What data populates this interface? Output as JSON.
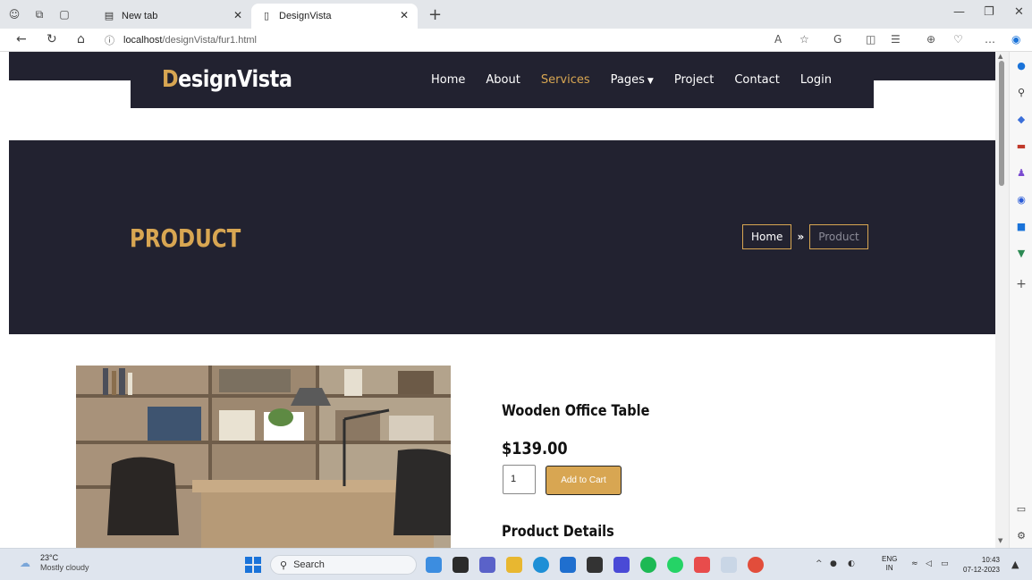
{
  "browser": {
    "tabs": [
      {
        "label": "New tab",
        "active": false,
        "icon": "new-tab-page-icon"
      },
      {
        "label": "DesignVista",
        "active": true,
        "icon": "page-icon"
      }
    ],
    "url_host": "localhost",
    "url_path": "/designVista/fur1.html"
  },
  "site": {
    "logo_first": "D",
    "logo_rest": "esignVista",
    "nav": [
      {
        "label": "Home"
      },
      {
        "label": "About"
      },
      {
        "label": "Services",
        "active": true
      },
      {
        "label": "Pages"
      },
      {
        "label": "Project"
      },
      {
        "label": "Contact"
      },
      {
        "label": "Login"
      }
    ],
    "colors": {
      "accent": "#d8a652",
      "dark": "#222230"
    }
  },
  "hero": {
    "title": "PRODUCT",
    "breadcrumb_home": "Home",
    "breadcrumb_current": "Product"
  },
  "product": {
    "name": "Wooden Office Table",
    "price": "$139.00",
    "quantity": "1",
    "add_to_cart": "Add to Cart",
    "details_heading": "Product Details"
  },
  "taskbar": {
    "temperature": "23°C",
    "condition": "Mostly cloudy",
    "search_placeholder": "Search",
    "lang_1": "ENG",
    "lang_2": "IN",
    "time": "10:43",
    "date": "07-12-2023"
  }
}
